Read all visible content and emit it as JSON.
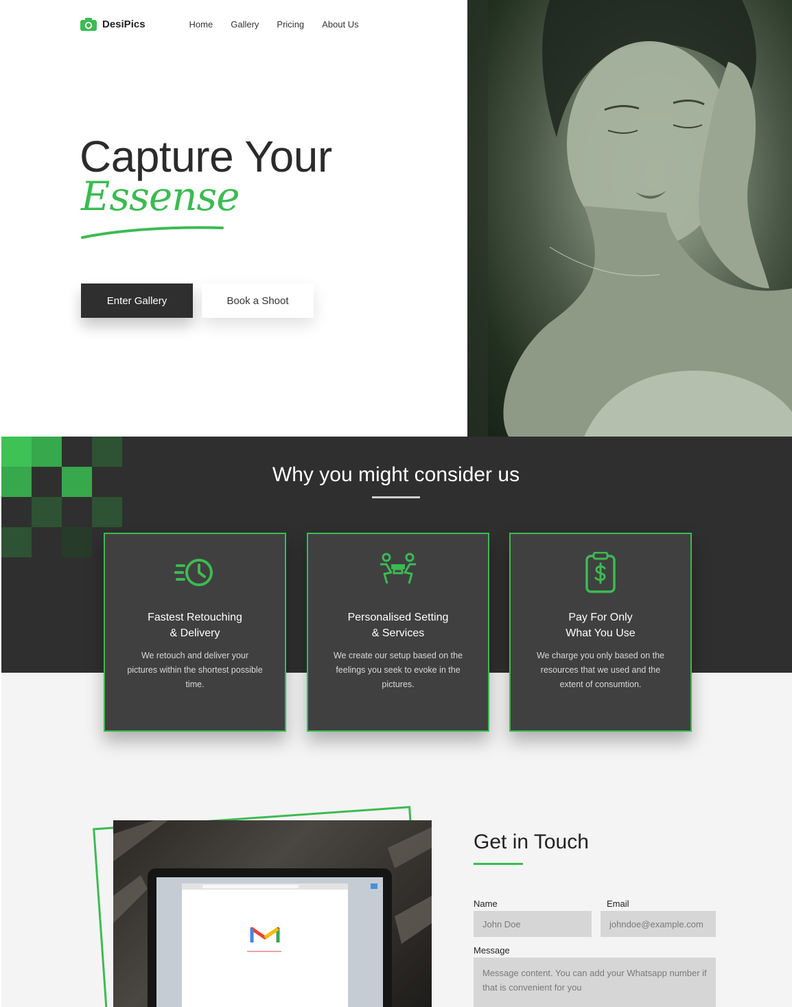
{
  "brand": {
    "name": "DesiPics",
    "logo_icon": "camera-icon"
  },
  "nav": {
    "items": [
      "Home",
      "Gallery",
      "Pricing",
      "About Us"
    ]
  },
  "hero": {
    "title": "Capture Your",
    "script_word": "Essense",
    "buttons": {
      "primary": "Enter Gallery",
      "secondary": "Book a Shoot"
    },
    "photo": "portrait-photo"
  },
  "why": {
    "title": "Why you might consider us",
    "cards": [
      {
        "icon": "fast-clock-icon",
        "title_line1": "Fastest Retouching",
        "title_line2": "& Delivery",
        "text": "We retouch and deliver your pictures within the shortest possible time."
      },
      {
        "icon": "meeting-people-icon",
        "title_line1": "Personalised Setting",
        "title_line2": "& Services",
        "text": "We create our setup based on the feelings you seek to evoke in the pictures."
      },
      {
        "icon": "clipboard-dollar-icon",
        "title_line1": "Pay For Only",
        "title_line2": "What You Use",
        "text": "We charge you only based on the resources that we used and the extent of consumtion."
      }
    ]
  },
  "contact": {
    "title": "Get in Touch",
    "name_label": "Name",
    "name_placeholder": "John Doe",
    "email_label": "Email",
    "email_placeholder": "johndoe@example.com",
    "message_label": "Message",
    "message_placeholder": "Message content. You can add your Whatsapp number if that is convenient for you"
  },
  "colors": {
    "accent": "#3cbb52",
    "dark": "#2f2f2f",
    "card": "#404040",
    "light_bg": "#f4f4f4",
    "field": "#d6d6d6"
  }
}
